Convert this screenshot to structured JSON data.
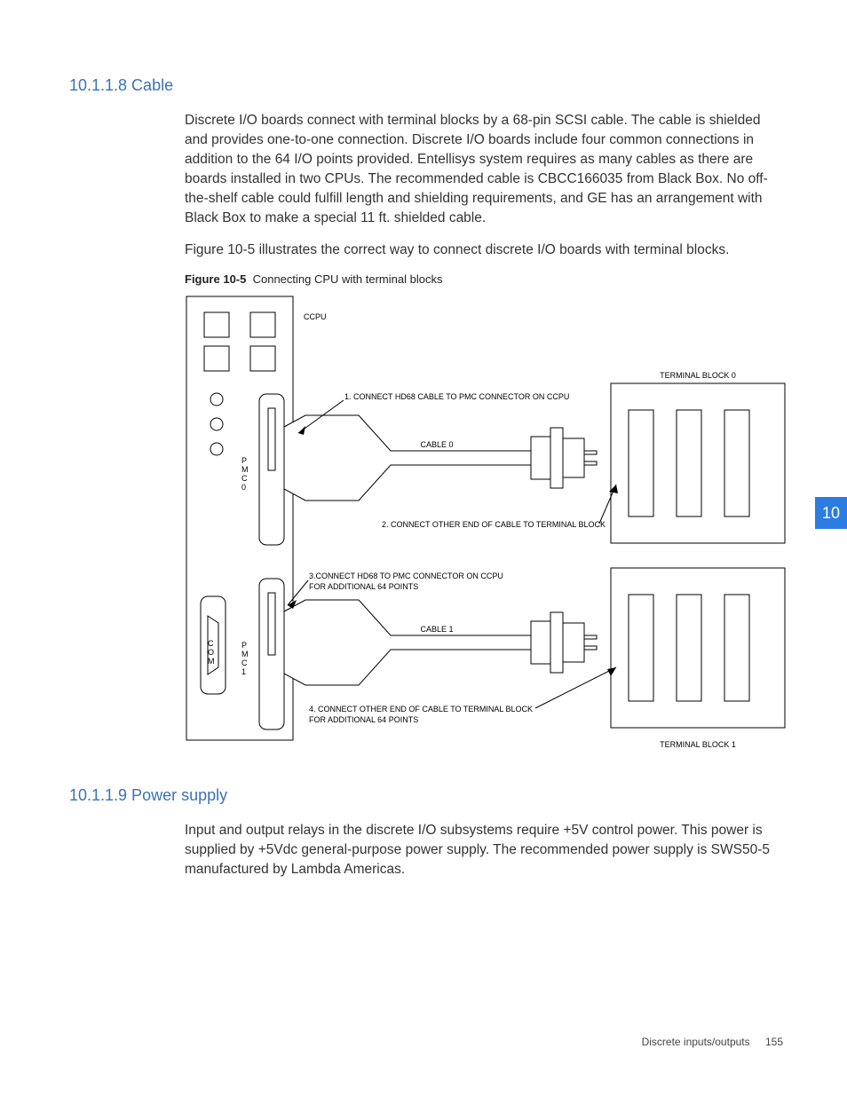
{
  "chapter_tab": "10",
  "sections": {
    "cable": {
      "heading": "10.1.1.8 Cable",
      "para1": "Discrete I/O boards connect with terminal blocks by a 68-pin SCSI cable. The cable is shielded and provides one-to-one connection. Discrete I/O boards include four common connections in addition to the 64 I/O points provided. Entellisys system requires as many cables as there are boards installed in two CPUs. The recommended cable is CBCC166035 from Black Box. No off-the-shelf cable could fulfill length and shielding requirements, and GE has an arrangement with Black Box to make a special 11 ft. shielded cable.",
      "para2": "Figure 10-5 illustrates the correct way to connect discrete I/O boards with terminal blocks.",
      "figure_label": "Figure 10-5",
      "figure_title": "Connecting CPU with terminal blocks"
    },
    "power": {
      "heading": "10.1.1.9 Power supply",
      "para1": "Input and output relays in the discrete I/O subsystems require +5V control power. This power is supplied by +5Vdc general-purpose power supply. The recommended power supply is SWS50-5 manufactured by Lambda Americas."
    }
  },
  "diagram": {
    "labels": {
      "ccpu": "CCPU",
      "tb0": "TERMINAL BLOCK 0",
      "tb1": "TERMINAL BLOCK 1",
      "pmc0": [
        "P",
        "M",
        "C",
        "0"
      ],
      "pmc1": [
        "P",
        "M",
        "C",
        "1"
      ],
      "com": [
        "C",
        "O",
        "M"
      ],
      "cable0": "CABLE 0",
      "cable1": "CABLE 1",
      "step1": "1. CONNECT HD68 CABLE TO PMC CONNECTOR ON CCPU",
      "step2": "2. CONNECT OTHER END OF CABLE TO TERMINAL BLOCK",
      "step3a": "3.CONNECT HD68 TO PMC CONNECTOR ON CCPU",
      "step3b": "FOR ADDITIONAL 64 POINTS",
      "step4a": "4. CONNECT OTHER END OF CABLE TO TERMINAL BLOCK",
      "step4b": "FOR ADDITIONAL 64 POINTS"
    }
  },
  "footer": {
    "section": "Discrete inputs/outputs",
    "page": "155"
  }
}
